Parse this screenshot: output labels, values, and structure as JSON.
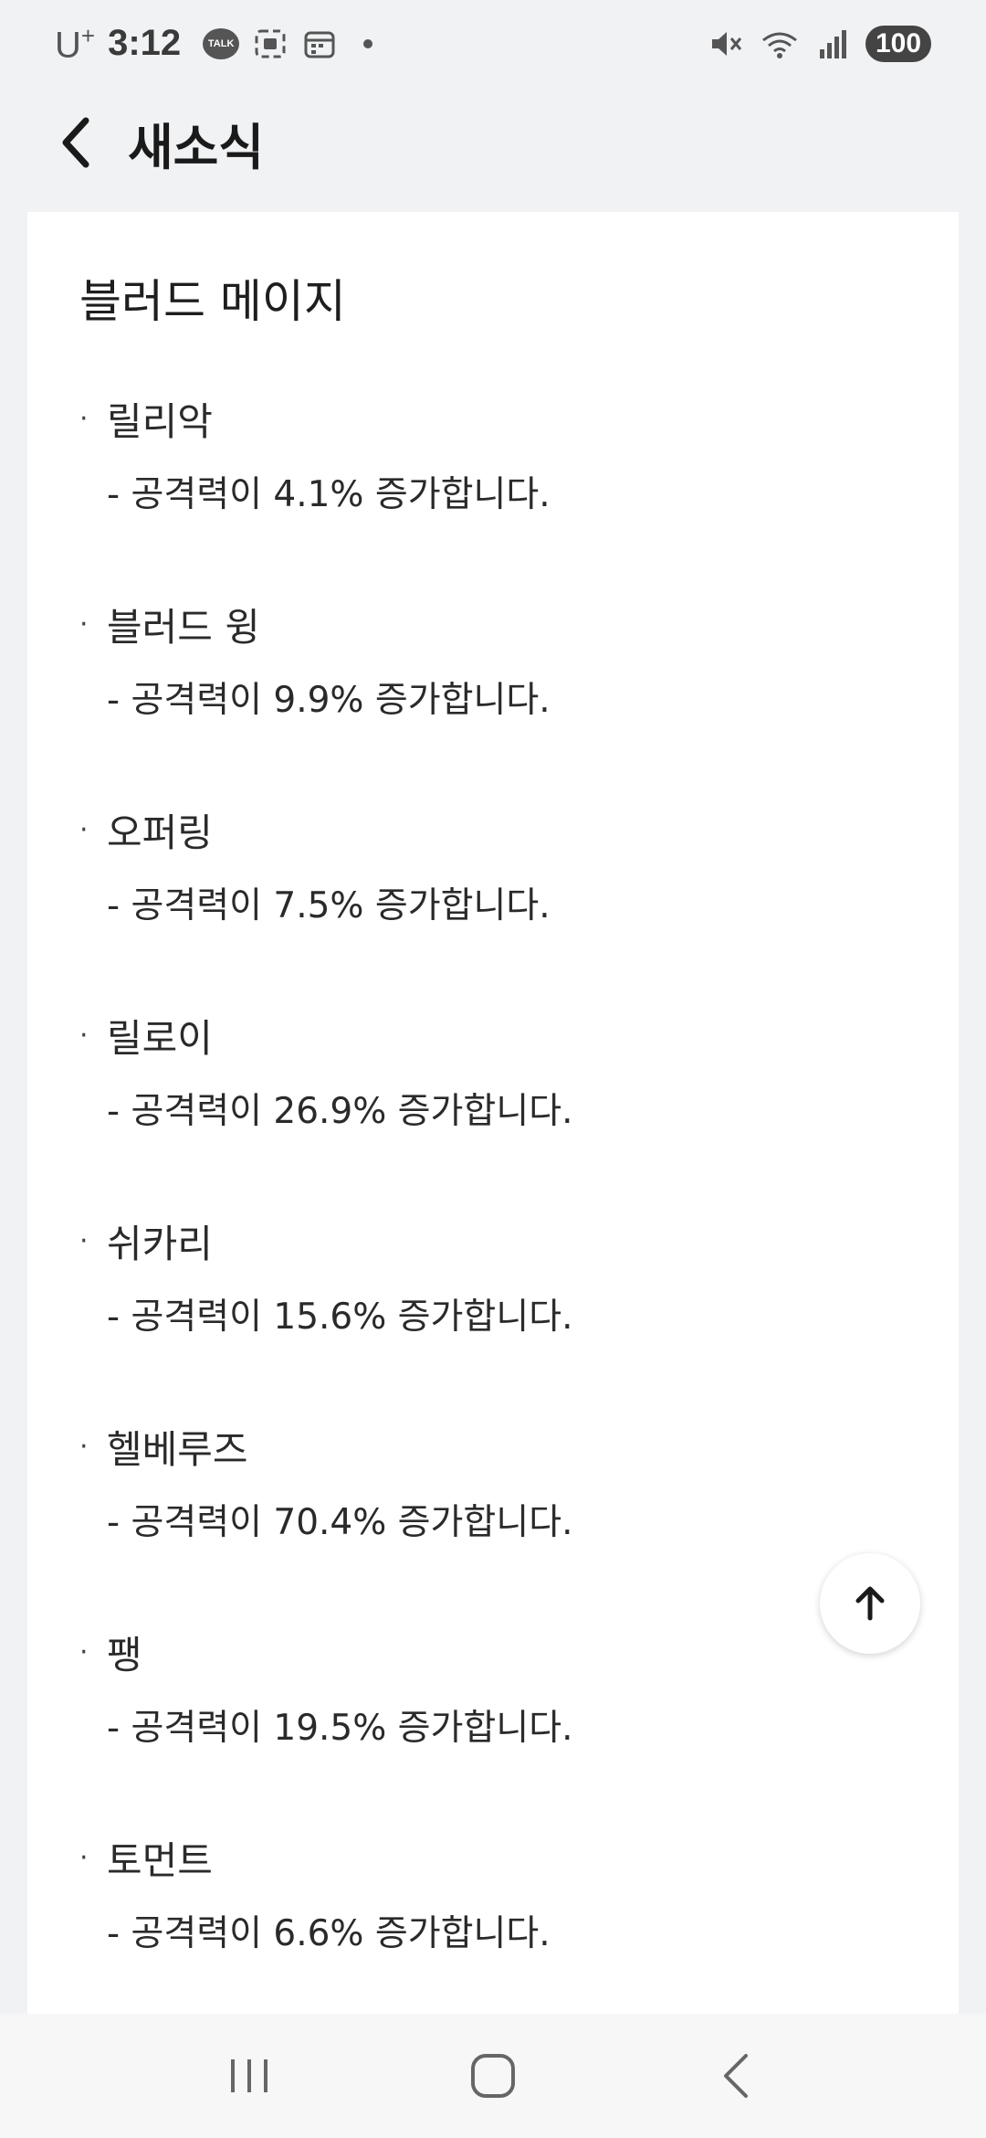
{
  "status_bar": {
    "carrier": "U",
    "carrier_plus": "+",
    "time": "3:12",
    "talk_label": "TALK",
    "battery": "100",
    "icons": [
      "talk-bubble-icon",
      "screenshot-icon",
      "calendar-icon",
      "notification-dot-icon",
      "mute-icon",
      "wifi-icon",
      "signal-icon",
      "battery-icon"
    ]
  },
  "header": {
    "title": "새소식",
    "back_icon": "chevron-left-icon"
  },
  "section": {
    "title": "블러드 메이지",
    "items": [
      {
        "bullet": "·",
        "name": "릴리악",
        "desc": "- 공격력이 4.1% 증가합니다."
      },
      {
        "bullet": "·",
        "name": "블러드 윙",
        "desc": "- 공격력이 9.9% 증가합니다."
      },
      {
        "bullet": "·",
        "name": "오퍼링",
        "desc": "- 공격력이 7.5% 증가합니다."
      },
      {
        "bullet": "·",
        "name": "릴로이",
        "desc": "- 공격력이 26.9% 증가합니다."
      },
      {
        "bullet": "·",
        "name": "쉬카리",
        "desc": "- 공격력이 15.6% 증가합니다."
      },
      {
        "bullet": "·",
        "name": "헬베루즈",
        "desc": "- 공격력이 70.4% 증가합니다."
      },
      {
        "bullet": "·",
        "name": "팽",
        "desc": "- 공격력이 19.5% 증가합니다."
      },
      {
        "bullet": "·",
        "name": "토먼트",
        "desc": "- 공격력이 6.6% 증가합니다."
      }
    ]
  },
  "scroll_top_icon": "arrow-up-icon",
  "nav_bar": {
    "buttons": [
      "recent-apps-icon",
      "home-icon",
      "back-icon"
    ]
  },
  "colors": {
    "background": "#f1f2f4",
    "card": "#ffffff",
    "text": "#1b1b1b"
  }
}
